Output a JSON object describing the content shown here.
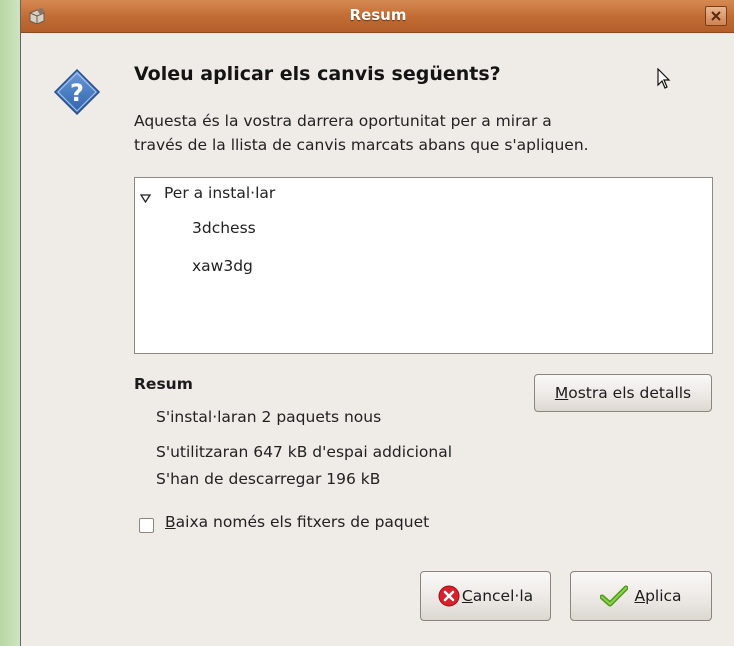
{
  "window": {
    "title": "Resum",
    "app_icon": "package-manager-icon",
    "close_icon": "close-icon"
  },
  "dialog": {
    "icon": "question-icon",
    "heading": "Voleu aplicar els canvis següents?",
    "description_lines": [
      "Aquesta és la vostra darrera oportunitat per a mirar a",
      "través de la llista de canvis marcats abans que s'apliquen."
    ]
  },
  "changes": {
    "group_label": "Per a instal·lar",
    "packages": [
      "3dchess",
      "xaw3dg"
    ]
  },
  "summary": {
    "title": "Resum",
    "details_button_first": "M",
    "details_button_rest": "ostra els detalls",
    "lines": [
      "S'instal·laran 2 paquets nous",
      "S'utilitzaran 647 kB d'espai addicional",
      "S'han de descarregar 196 kB"
    ]
  },
  "download_only": {
    "label_first": "B",
    "label_rest": "aixa només els fitxers de paquet",
    "checked": false
  },
  "buttons": {
    "cancel_first": "C",
    "cancel_rest": "ancel·la",
    "apply_first": "A",
    "apply_rest": "plica"
  },
  "colors": {
    "titlebar": "#c26d35",
    "dialog_bg": "#efebe7",
    "question_icon": "#3c74c0",
    "cancel_icon": "#d8202a",
    "apply_icon": "#5fae22"
  }
}
